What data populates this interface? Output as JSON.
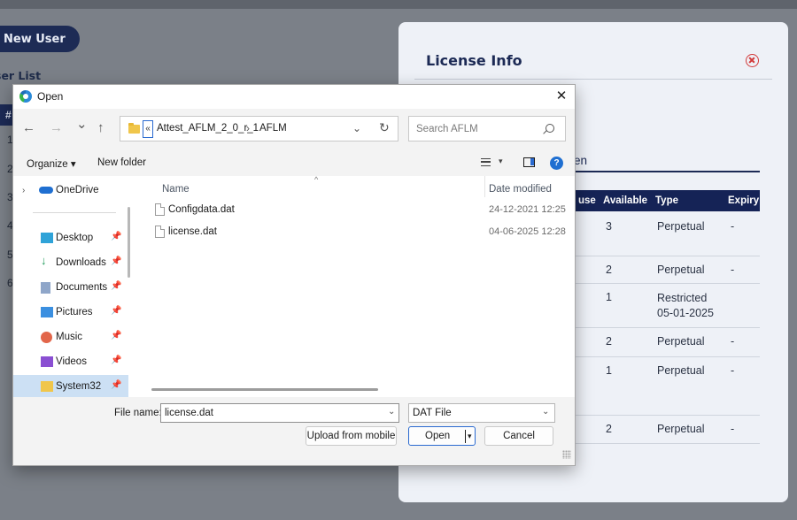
{
  "background": {
    "new_user_button": "New User",
    "user_list_label": "ser List",
    "table_head_hash": "#",
    "row_numbers": [
      "1",
      "2",
      "3",
      "4",
      "5",
      "6"
    ]
  },
  "license_panel": {
    "title": "License Info",
    "tab_label": "en",
    "columns": [
      "use",
      "Available",
      "Type",
      "Expiry"
    ],
    "rows": [
      {
        "available": "3",
        "type": "Perpetual",
        "expiry": "-"
      },
      {
        "available": "2",
        "type": "Perpetual",
        "expiry": "-"
      },
      {
        "available": "1",
        "type": "Restricted\n05-01-2025",
        "expiry": ""
      },
      {
        "available": "2",
        "type": "Perpetual",
        "expiry": "-"
      },
      {
        "available": "1",
        "type": "Perpetual",
        "expiry": "-"
      },
      {
        "available": "2",
        "type": "Perpetual",
        "expiry": "-"
      }
    ]
  },
  "dialog": {
    "title": "Open",
    "close_glyph": "✕",
    "nav": {
      "back": "←",
      "forward": "→",
      "recent": "⌄",
      "up": "↑"
    },
    "address": {
      "overflow": "«",
      "crumbs": [
        "Attest_AFLM_2_0_r_1",
        "AFLM"
      ],
      "separator": "›",
      "dropdown": "⌄",
      "refresh": "↻"
    },
    "search_placeholder": "Search AFLM",
    "toolbar": {
      "organize": "Organize ▾",
      "new_folder": "New folder",
      "view_dropdown": "▾",
      "help": "?"
    },
    "nav_pane": {
      "expand": "›",
      "pin": "📌",
      "items": [
        {
          "label": "OneDrive",
          "pinned": false
        },
        {
          "label": "Desktop",
          "pinned": true
        },
        {
          "label": "Downloads",
          "pinned": true
        },
        {
          "label": "Documents",
          "pinned": true
        },
        {
          "label": "Pictures",
          "pinned": true
        },
        {
          "label": "Music",
          "pinned": true
        },
        {
          "label": "Videos",
          "pinned": true
        },
        {
          "label": "System32",
          "pinned": true,
          "selected": true
        }
      ]
    },
    "columns": {
      "name": "Name",
      "date_modified": "Date modified",
      "sort_arrow": "^"
    },
    "files": [
      {
        "name": "Configdata.dat",
        "date": "24-12-2021 12:25"
      },
      {
        "name": "license.dat",
        "date": "04-06-2025 12:28"
      }
    ],
    "bottom": {
      "file_name_label": "File name:",
      "file_name_value": "license.dat",
      "file_type": "DAT File",
      "dropdown": "⌄",
      "open_caret": "▾",
      "upload_button": "Upload from mobile",
      "open_button": "Open",
      "cancel_button": "Cancel"
    }
  },
  "colors": {
    "accent": "#2a6ad0",
    "navy": "#152356",
    "close_red": "#d23a3a"
  }
}
